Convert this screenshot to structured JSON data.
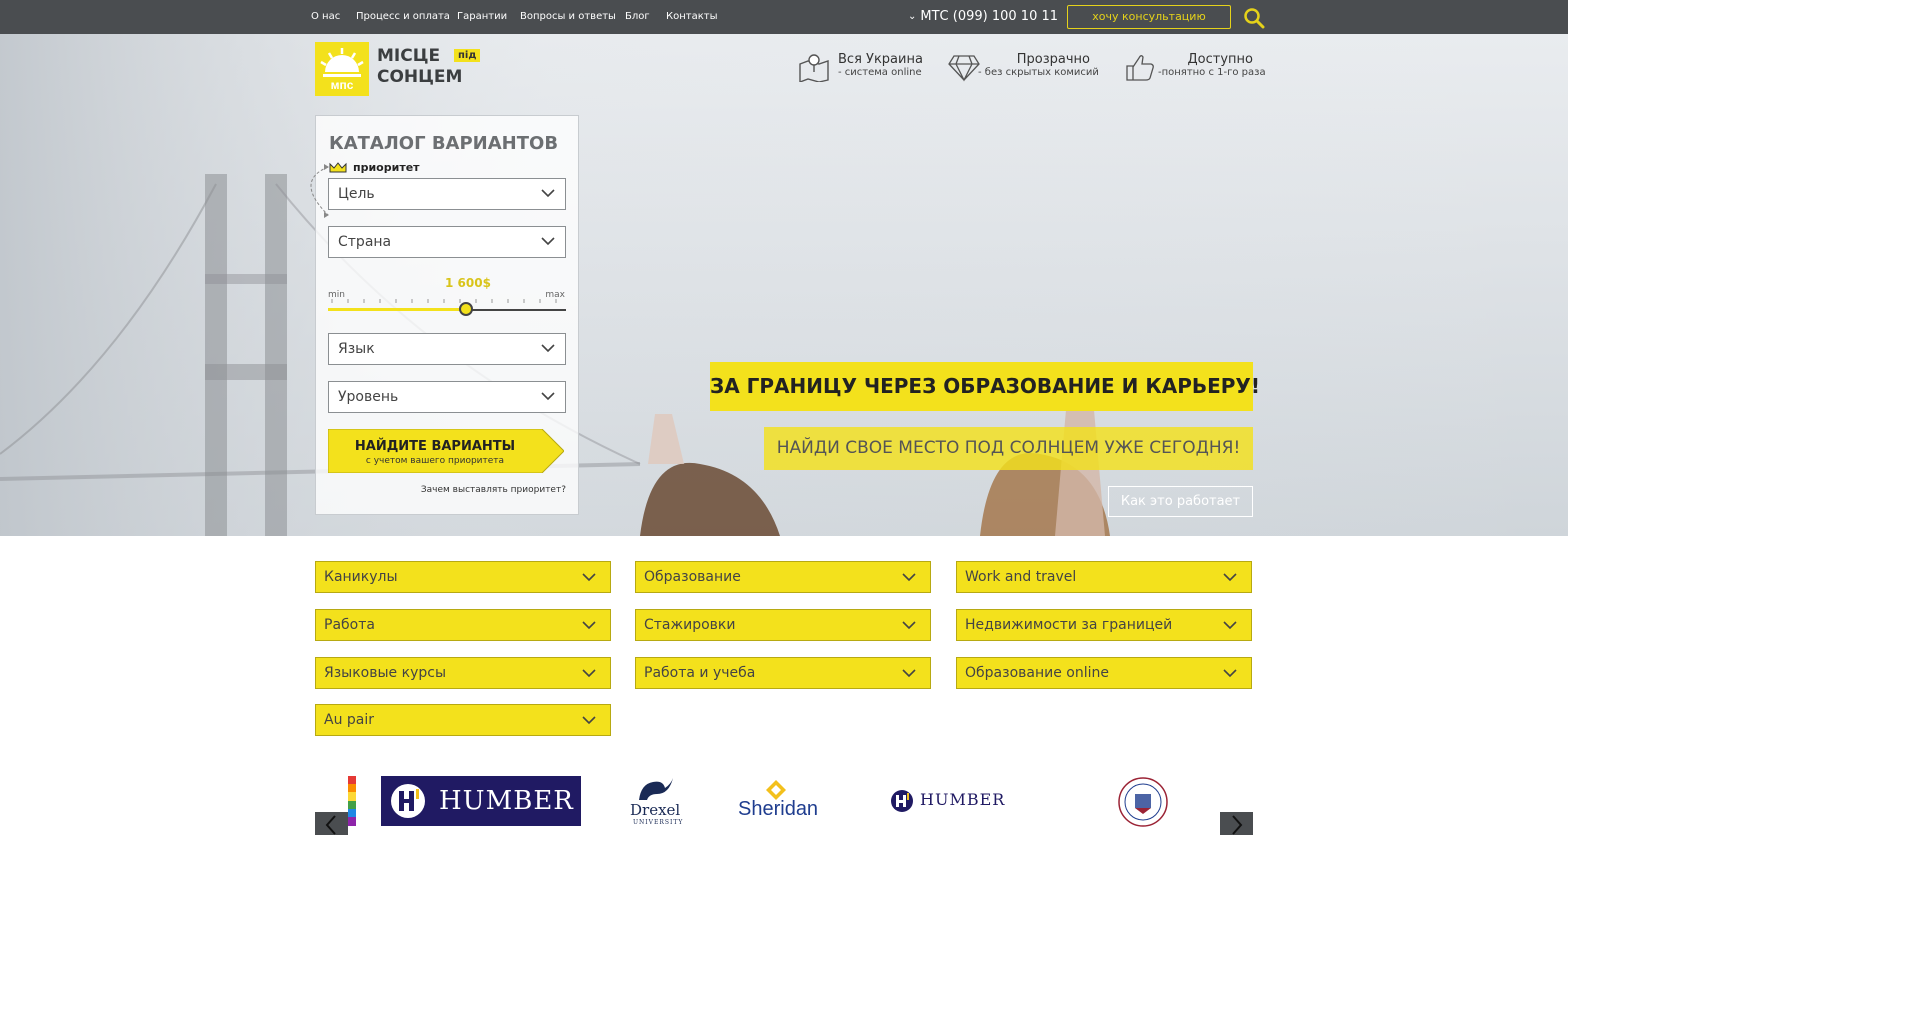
{
  "topnav": {
    "links": [
      "О нас",
      "Процесс и оплата",
      "Гарантии",
      "Вопросы и ответы",
      "Блог",
      "Контакты"
    ],
    "phone": "МТС (099) 100 10 11",
    "consult_button": "хочу консультацию"
  },
  "logo": {
    "line1": "МІСЦЕ",
    "line2": "СОНЦЕМ",
    "badge": "під",
    "emblem_text": "мпс"
  },
  "features": [
    {
      "title": "Вся Украина",
      "subtitle": "- система online",
      "icon": "map-icon"
    },
    {
      "title": "Прозрачно",
      "subtitle": "- без скрытых комисий",
      "icon": "diamond-icon"
    },
    {
      "title": "Доступно",
      "subtitle": "-понятно с 1-го раза",
      "icon": "thumbs-up-icon"
    }
  ],
  "catalog": {
    "title": "КАТАЛОГ ВАРИАНТОВ",
    "priority_label": "приоритет",
    "selects": [
      "Цель",
      "Страна",
      "Язык",
      "Уровень"
    ],
    "range": {
      "value_label": "1 600$",
      "min_label": "min",
      "max_label": "max",
      "position_fraction": 0.58
    },
    "find_button_title": "НАЙДИТЕ ВАРИАНТЫ",
    "find_button_subtitle": "с учетом вашего приоритета",
    "why_link": "Зачем выставлять приоритет?"
  },
  "hero": {
    "headline": "ЗА ГРАНИЦУ ЧЕРЕЗ ОБРАЗОВАНИЕ И КАРЬЕРУ!",
    "subline": "НАЙДИ СВОЕ МЕСТО ПОД СОЛНЦЕМ УЖЕ СЕГОДНЯ!",
    "how_button": "Как это работает"
  },
  "categories": [
    "Каникулы",
    "Образование",
    "Work and travel",
    "Работа",
    "Стажировки",
    "Недвижимости за границей",
    "Языковые курсы",
    "Работа и учеба",
    "Образование online",
    "Au pair"
  ],
  "partners": {
    "logo1": "HUMBER",
    "logo2_main": "Drexel",
    "logo2_sub": "UNIVERSITY",
    "logo3": "Sheridan",
    "logo4": "HUMBER"
  },
  "colors": {
    "accent": "#f3e11c",
    "topbar": "#4a4d50"
  }
}
